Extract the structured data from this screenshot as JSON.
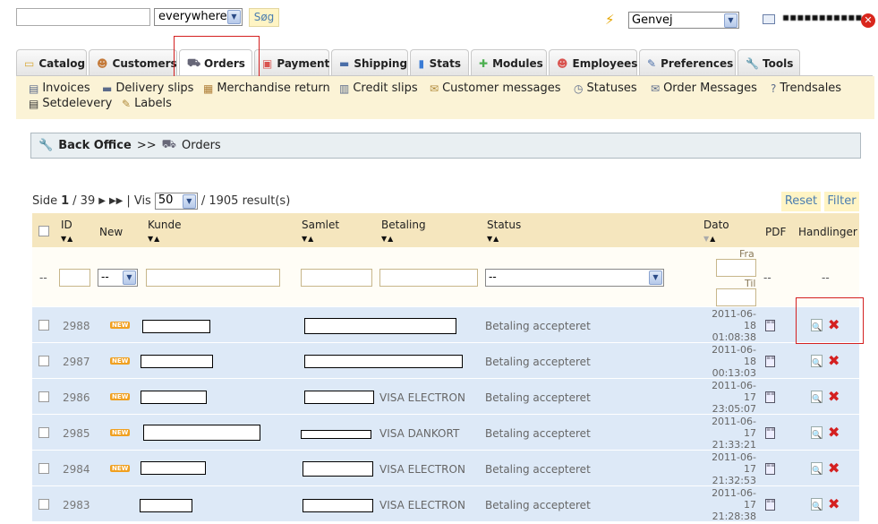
{
  "search": {
    "value": "",
    "scope": "everywhere",
    "button": "Søg"
  },
  "quick_access": {
    "value": "Genvej"
  },
  "user": {
    "name": "▪▪▪▪▪▪▪▪▪▪▪"
  },
  "tabs": [
    {
      "label": "Catalog",
      "icon": "folder-icon"
    },
    {
      "label": "Customers",
      "icon": "person-icon"
    },
    {
      "label": "Orders",
      "icon": "cart-icon"
    },
    {
      "label": "Payment",
      "icon": "payment-icon"
    },
    {
      "label": "Shipping",
      "icon": "truck-icon"
    },
    {
      "label": "Stats",
      "icon": "bar-chart-icon"
    },
    {
      "label": "Modules",
      "icon": "puzzle-icon"
    },
    {
      "label": "Employees",
      "icon": "employee-icon"
    },
    {
      "label": "Preferences",
      "icon": "preferences-icon"
    },
    {
      "label": "Tools",
      "icon": "wrench-icon"
    }
  ],
  "subnav": [
    {
      "label": "Invoices"
    },
    {
      "label": "Delivery slips"
    },
    {
      "label": "Merchandise return"
    },
    {
      "label": "Credit slips"
    },
    {
      "label": "Customer messages"
    },
    {
      "label": "Statuses"
    },
    {
      "label": "Order Messages"
    },
    {
      "label": "Trendsales"
    },
    {
      "label": "Setdelevery"
    },
    {
      "label": "Labels"
    }
  ],
  "breadcrumb": {
    "root": "Back Office",
    "sep": ">>",
    "current": "Orders"
  },
  "pager": {
    "page_label": "Side",
    "page": "1",
    "total_pages": "/ 39",
    "per_page_label": "| Vis",
    "per_page": "50",
    "results": "/ 1905 result(s)"
  },
  "buttons": {
    "reset": "Reset",
    "filter": "Filter"
  },
  "columns": {
    "id": "ID",
    "new": "New",
    "customer": "Kunde",
    "total": "Samlet",
    "payment": "Betaling",
    "status": "Status",
    "date": "Dato",
    "pdf": "PDF",
    "actions": "Handlinger"
  },
  "filters": {
    "new_value": "--",
    "status_value": "--",
    "date_from": "Fra",
    "date_to": "Til",
    "empty": "--"
  },
  "new_badge": "NEW",
  "rows": [
    {
      "id": "2988",
      "new": true,
      "payment": "",
      "status": "Betaling accepteret",
      "date1": "2011-06-",
      "date2": "18",
      "date3": "01:08:38"
    },
    {
      "id": "2987",
      "new": true,
      "payment": "",
      "status": "Betaling accepteret",
      "date1": "2011-06-",
      "date2": "18",
      "date3": "00:13:03"
    },
    {
      "id": "2986",
      "new": true,
      "payment": "VISA ELECTRON",
      "status": "Betaling accepteret",
      "date1": "2011-06-",
      "date2": "17",
      "date3": "23:05:07"
    },
    {
      "id": "2985",
      "new": true,
      "payment": "VISA DANKORT",
      "status": "Betaling accepteret",
      "date1": "2011-06-",
      "date2": "17",
      "date3": "21:33:21"
    },
    {
      "id": "2984",
      "new": true,
      "payment": "VISA ELECTRON",
      "status": "Betaling accepteret",
      "date1": "2011-06-",
      "date2": "17",
      "date3": "21:32:53"
    },
    {
      "id": "2983",
      "new": false,
      "payment": "VISA ELECTRON",
      "status": "Betaling accepteret",
      "date1": "2011-06-",
      "date2": "17",
      "date3": "21:28:38"
    }
  ]
}
